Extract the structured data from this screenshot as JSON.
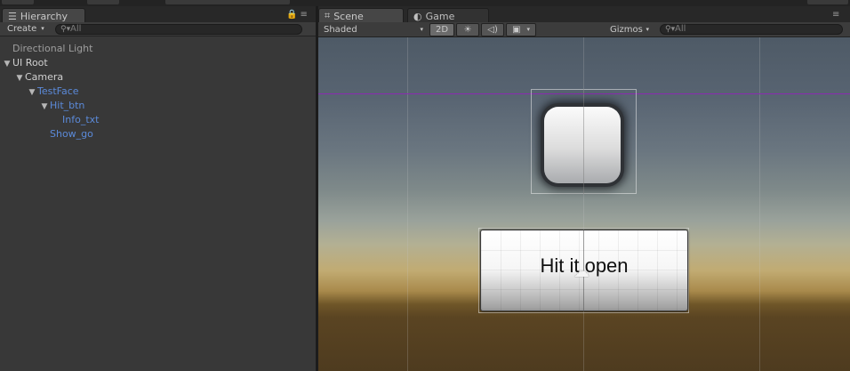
{
  "hierarchy": {
    "tab_label": "Hierarchy",
    "create_label": "Create",
    "search_placeholder": "All",
    "items": [
      {
        "label": "Directional Light",
        "indent": 0,
        "arrow": false
      },
      {
        "label": "UI Root",
        "indent": 0,
        "arrow": true
      },
      {
        "label": "Camera",
        "indent": 1,
        "arrow": true
      },
      {
        "label": "TestFace",
        "indent": 2,
        "arrow": true
      },
      {
        "label": "Hit_btn",
        "indent": 3,
        "arrow": true
      },
      {
        "label": "Info_txt",
        "indent": 4,
        "arrow": false
      },
      {
        "label": "Show_go",
        "indent": 3,
        "arrow": false
      }
    ]
  },
  "scene": {
    "tab_scene": "Scene",
    "tab_game": "Game",
    "shading_mode": "Shaded",
    "mode_2d": "2D",
    "gizmos_label": "Gizmos",
    "search_placeholder": "All",
    "button_label": "Hit it open"
  },
  "colors": {
    "panel_bg": "#383838",
    "selected_blue": "#5b8ad9",
    "viewport_line": "#8a2bb0"
  }
}
